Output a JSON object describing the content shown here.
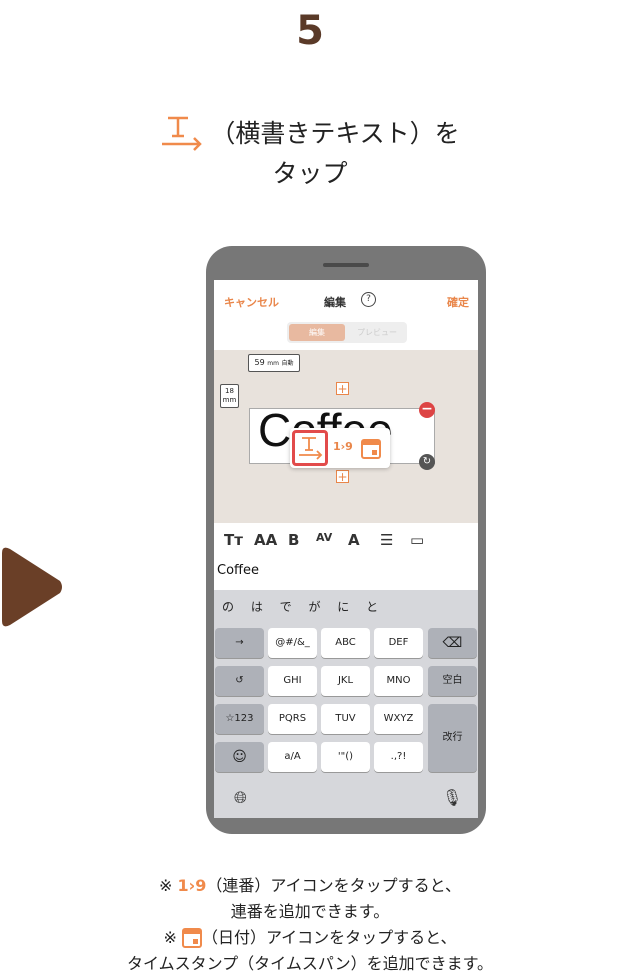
{
  "step_number": "5",
  "instruction": {
    "line1": "（横書きテキスト）を",
    "line2": "タップ"
  },
  "app": {
    "cancel": "キャンセル",
    "title": "編集",
    "help": "?",
    "confirm": "確定",
    "tabs": [
      "編集",
      "プレビュー"
    ],
    "width_value": "59",
    "width_unit": "mm",
    "width_mode": "自動",
    "height_value": "18",
    "height_unit": "mm",
    "label_text": "Coffee",
    "serial_label": "1›9",
    "input_text": "Coffee"
  },
  "keyboard": {
    "candidates": "の は で が に と",
    "rows": [
      [
        "→",
        "@#/&_",
        "ABC",
        "DEF",
        "⌫"
      ],
      [
        "↺",
        "GHI",
        "JKL",
        "MNO",
        "空白"
      ],
      [
        "☆123",
        "PQRS",
        "TUV",
        "WXYZ",
        "改行"
      ],
      [
        "☺",
        "a/A",
        "'\"()",
        ".,?!"
      ]
    ]
  },
  "notes": {
    "line1_prefix": "※ ",
    "line1_num": "1›9",
    "line1_rest": "（連番）アイコンをタップすると、",
    "line2": "連番を追加できます。",
    "line3_prefix": "※ ",
    "line3_rest": "（日付）アイコンをタップすると、",
    "line4": "タイムスタンプ（タイムスパン）を追加できます。"
  },
  "colors": {
    "accent": "#f08a4b",
    "brown": "#5a3a28",
    "highlight": "#e24b4b"
  }
}
